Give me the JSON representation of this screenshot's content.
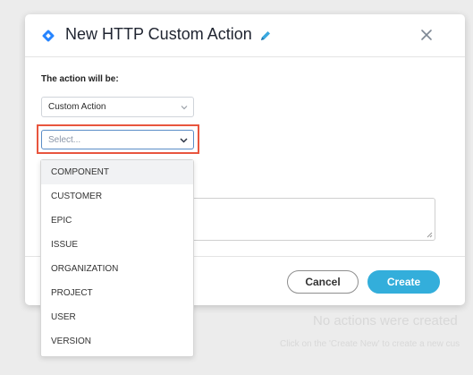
{
  "background": {
    "empty_title": "No actions were created",
    "empty_hint": "Click on the 'Create New' to create a new cus"
  },
  "modal": {
    "title": "New HTTP Custom Action",
    "action_label": "The action will be:",
    "action_select_value": "Custom Action",
    "type_select_placeholder": "Select...",
    "cancel_label": "Cancel",
    "create_label": "Create"
  },
  "dropdown": {
    "options": [
      "COMPONENT",
      "CUSTOMER",
      "EPIC",
      "ISSUE",
      "ORGANIZATION",
      "PROJECT",
      "USER",
      "VERSION"
    ]
  },
  "colors": {
    "accent": "#33aedb",
    "highlight": "#e8553e",
    "brand_icon": "#2684ff"
  },
  "icons": {
    "header": "jira-diamond-icon",
    "edit": "pencil-icon",
    "close": "close-icon",
    "select": "chevron-down-icon"
  }
}
